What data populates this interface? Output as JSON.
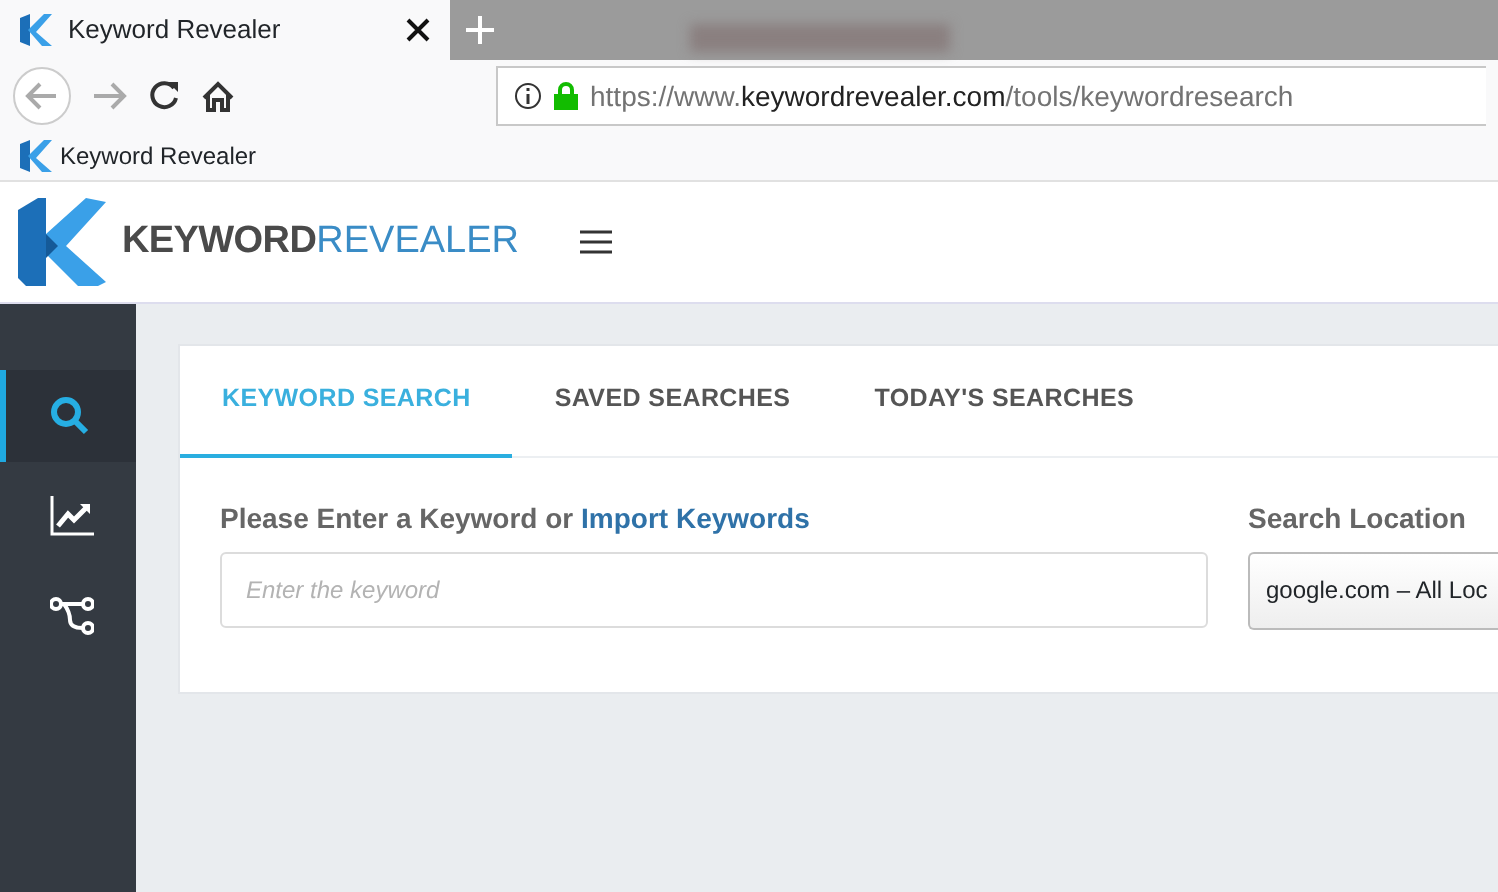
{
  "browser": {
    "tabs": [
      {
        "title": "Keyword Revealer",
        "selected": true
      },
      {
        "blurred": true,
        "selected": false
      }
    ],
    "address": {
      "prefix": "https://www.",
      "domain": "keywordrevealer.com",
      "path": "/tools/keywordresearch"
    },
    "bookmarks": [
      {
        "label": "Keyword Revealer"
      }
    ]
  },
  "header": {
    "logo_bold": "KEYWORD",
    "logo_light": "REVEALER"
  },
  "sidebar": {
    "items": [
      {
        "kind": "search",
        "selected": true
      },
      {
        "kind": "chart",
        "selected": false
      },
      {
        "kind": "branch",
        "selected": false
      }
    ]
  },
  "tabs": [
    {
      "label": "KEYWORD SEARCH",
      "selected": true
    },
    {
      "label": "SAVED SEARCHES",
      "selected": false
    },
    {
      "label": "TODAY'S SEARCHES",
      "selected": false
    }
  ],
  "keyword": {
    "label": "Please Enter a Keyword or ",
    "link": "Import Keywords",
    "placeholder": "Enter the keyword"
  },
  "location": {
    "label": "Search Location",
    "value": "google.com – All Loc"
  }
}
